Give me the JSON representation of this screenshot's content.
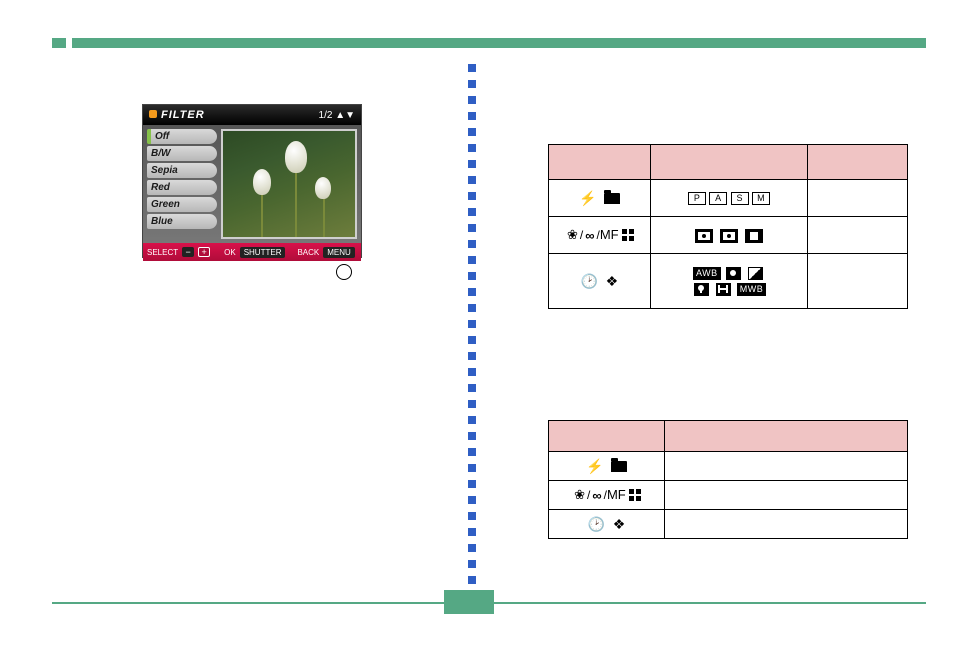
{
  "lcd": {
    "title": "FILTER",
    "pager": "1/2 ▲▼",
    "menu": [
      "Off",
      "B/W",
      "Sepia",
      "Red",
      "Green",
      "Blue"
    ],
    "footer": {
      "select": "SELECT",
      "ok": "OK",
      "back": "BACK",
      "shutter": "SHUTTER",
      "menu": "MENU",
      "minus": "−",
      "plus": "+"
    }
  },
  "table1": {
    "row2_letters": [
      "P",
      "A",
      "S",
      "M"
    ],
    "row3_mf": "MF",
    "row4_awb": "AWB",
    "row4_mwb": "MWB"
  },
  "table2": {
    "row2_mf": "MF"
  },
  "icons": {
    "flash": "⚡",
    "macro": "❀",
    "infinity": "∞",
    "slash": "/",
    "timer": "🕑",
    "diamond": "❖"
  }
}
